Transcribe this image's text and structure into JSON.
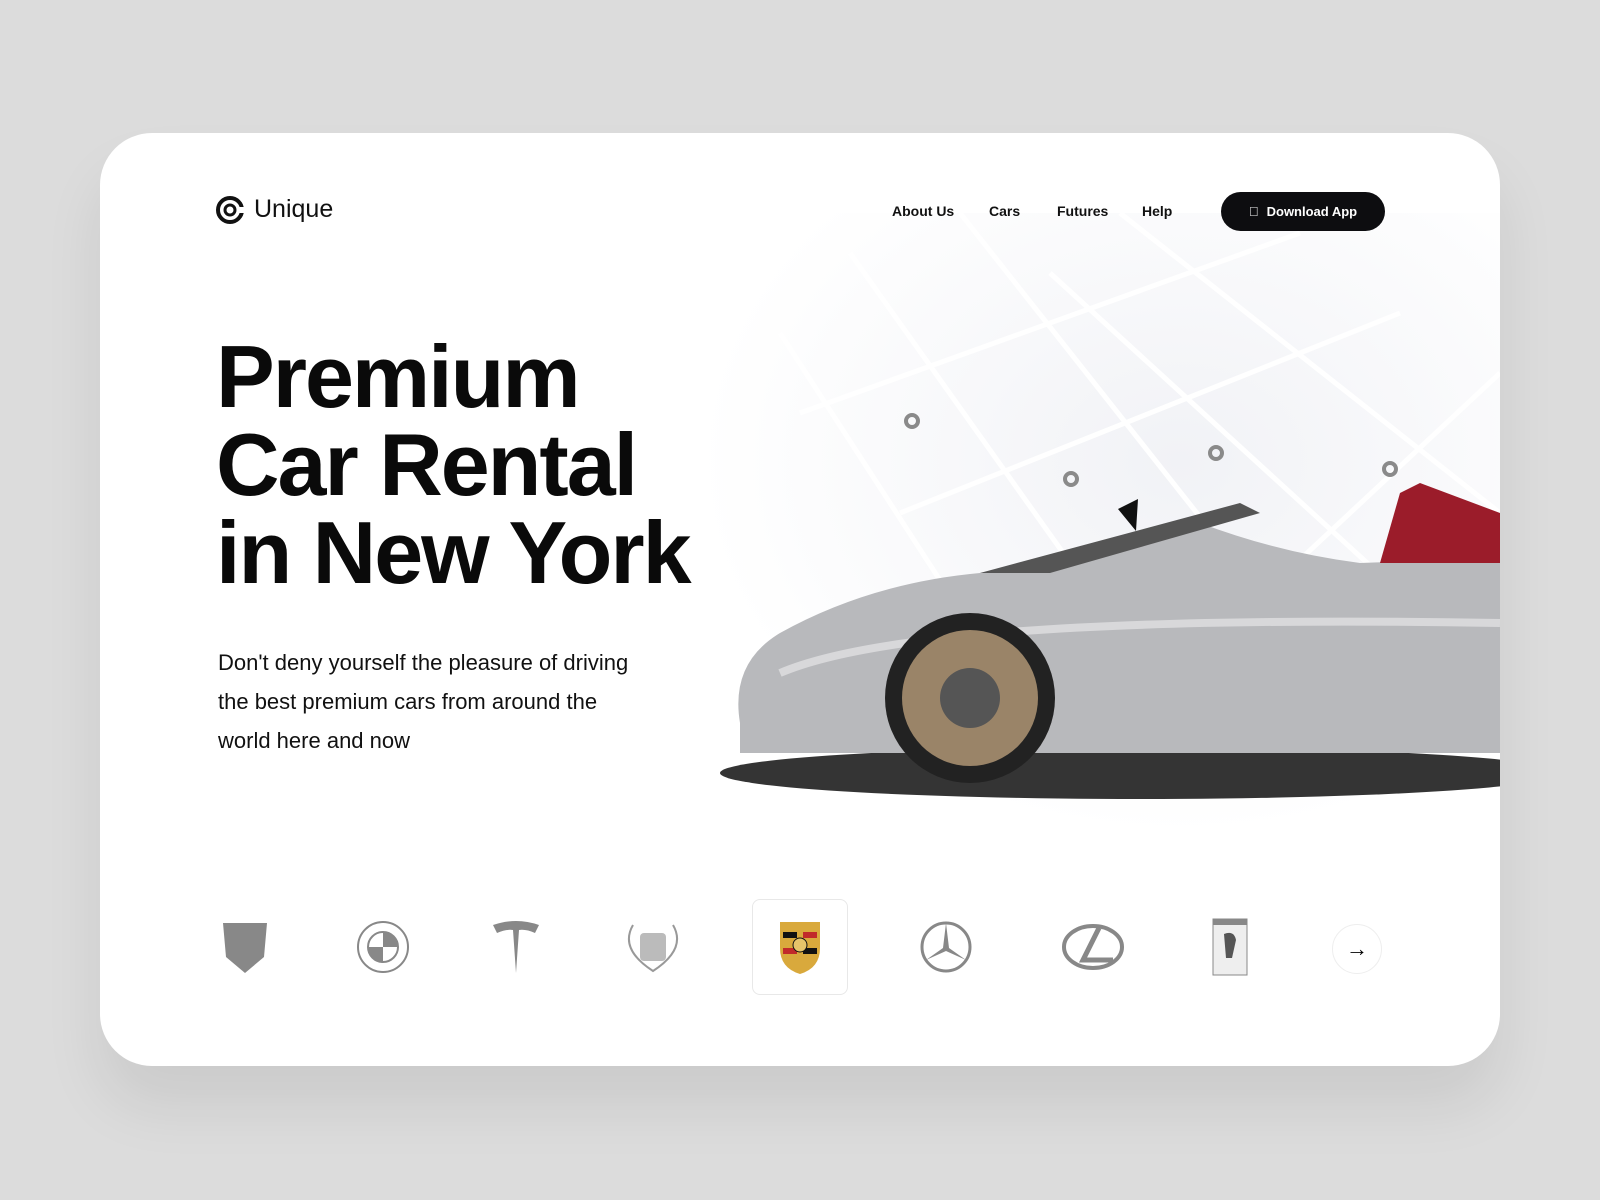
{
  "brand": {
    "name": "Unique"
  },
  "nav": {
    "items": [
      "About Us",
      "Cars",
      "Futures",
      "Help"
    ],
    "download": "Download App"
  },
  "hero": {
    "line1": "Premium",
    "line2": "Car Rental",
    "line3": "in New York",
    "subtitle": "Don't deny yourself the pleasure of driving the best premium cars from around the world here and now"
  },
  "brands": [
    "Lamborghini",
    "BMW",
    "Tesla",
    "Cadillac",
    "Porsche",
    "Mercedes-Benz",
    "Lexus",
    "Ferrari"
  ],
  "selected_brand": "Porsche",
  "colors": {
    "accent": "#0d0d10",
    "seat": "#9b1c2a",
    "car": "#b8b9bc"
  }
}
